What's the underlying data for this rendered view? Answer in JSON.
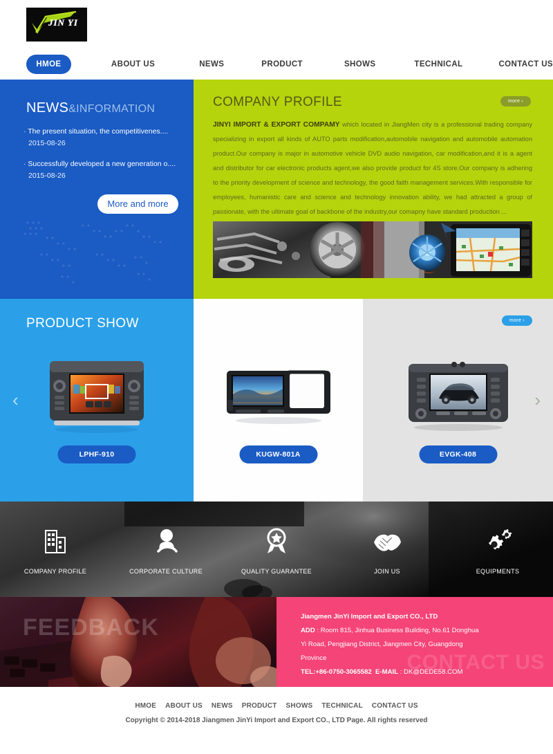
{
  "header": {
    "logo_text": "JIN YI",
    "nav": [
      {
        "label": "HMOE",
        "active": true
      },
      {
        "label": "ABOUT US",
        "active": false
      },
      {
        "label": "NEWS",
        "active": false
      },
      {
        "label": "PRODUCT",
        "active": false
      },
      {
        "label": "SHOWS",
        "active": false
      },
      {
        "label": "TECHNICAL",
        "active": false
      },
      {
        "label": "CONTACT US",
        "active": false
      }
    ]
  },
  "news": {
    "title_main": "NEWS",
    "title_sub": "&INFORMATION",
    "items": [
      {
        "title": "The present situation, the competitivenes....",
        "date": "2015-08-26"
      },
      {
        "title": "Successfully developed a new generation o....",
        "date": "2015-08-26"
      }
    ],
    "more_label": "More and more"
  },
  "profile": {
    "title": "COMPANY PROFILE",
    "more_label": "more ›",
    "lead": "JINYI IMPORT & EXPORT COMPAMY",
    "body": " which located in JiangMen city is a professional trading company specializing in export all kinds of AUTO parts modification,automobile navigation and automobile automation product.Our company is major in automotive vehicle DVD audio navigation, car modification,and it is a agent and distributor for car electronic products agent,we also provide product for 4S store.Our company is adhering to the priority development of science and technology, the good faith management services.With responsible for employees, humanistic care and science and technology innovation ability, we had attracted a group of passionate, with the ultimate goal of backbone of the industry,our comapny have standard production ..."
  },
  "products": {
    "title": "PRODUCT SHOW",
    "more_label": "more ›",
    "prev_arrow": "‹",
    "next_arrow": "›",
    "items": [
      {
        "code": "LPHF-910"
      },
      {
        "code": "KUGW-801A"
      },
      {
        "code": "EVGK-408"
      }
    ]
  },
  "features": [
    {
      "label": "COMPANY PROFILE",
      "icon": "building-icon"
    },
    {
      "label": "CORPORATE CULTURE",
      "icon": "person-icon"
    },
    {
      "label": "QUALITY GUARANTEE",
      "icon": "award-ribbon-icon"
    },
    {
      "label": "JOIN US",
      "icon": "handshake-icon"
    },
    {
      "label": "EQUIPMENTS",
      "icon": "gears-icon"
    }
  ],
  "feedback": {
    "watermark": "FEEDBACK"
  },
  "contact": {
    "watermark": "CONTACT US",
    "company": "Jiangmen JinYi Import and Export CO., LTD",
    "add_label": "ADD",
    "address_line1": " : Room 815, Jinhua Business Building, No.61 Donghua",
    "address_line2": "Yi Road, Pengjiang District, Jiangmen City, Guangdong",
    "address_line3": "Province",
    "tel": "TEL:+86-0750-3065582",
    "email_label": "E-MAIL",
    "email": " : DK@DEDE58.COM"
  },
  "footer": {
    "nav": [
      "HMOE",
      "ABOUT US",
      "NEWS",
      "PRODUCT",
      "SHOWS",
      "TECHNICAL",
      "CONTACT US"
    ],
    "copyright": "Copyright © 2014-2018 Jiangmen JinYi Import and Export CO., LTD   Page. All rights reserved"
  },
  "colors": {
    "brand_blue": "#1a5bc4",
    "brand_green": "#b5d40c",
    "light_blue": "#2ba0e8",
    "pink": "#f54478",
    "dark": "#1b1b1b"
  }
}
